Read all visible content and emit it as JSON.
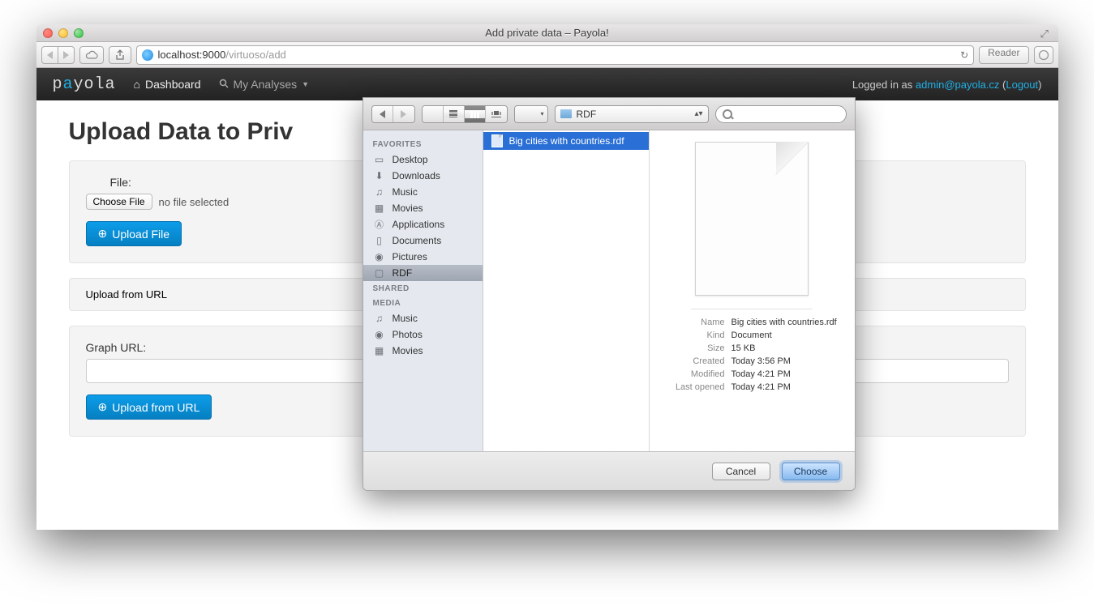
{
  "window": {
    "title": "Add private data – Payola!",
    "url_host": "localhost:9000",
    "url_path": "/virtuoso/add",
    "reader": "Reader"
  },
  "navbar": {
    "brand_p1": "p",
    "brand_accent": "a",
    "brand_p2": "yola",
    "dashboard": "Dashboard",
    "my_analyses": "My Analyses",
    "logged_in_prefix": "Logged in as ",
    "user": "admin@payola.cz",
    "logout": "Logout"
  },
  "page": {
    "heading": "Upload Data to Priv",
    "file_label": "File:",
    "choose_file": "Choose File",
    "no_file": "no file selected",
    "upload_file": "Upload File",
    "upload_from_url_label": "Upload from URL",
    "graph_url_label": "Graph URL:",
    "upload_from_url_btn": "Upload from URL"
  },
  "dialog": {
    "path": "RDF",
    "sidebar": {
      "favorites_header": "FAVORITES",
      "favorites": [
        "Desktop",
        "Downloads",
        "Music",
        "Movies",
        "Applications",
        "Documents",
        "Pictures",
        "RDF"
      ],
      "shared_header": "SHARED",
      "media_header": "MEDIA",
      "media": [
        "Music",
        "Photos",
        "Movies"
      ]
    },
    "file": "Big cities with countries.rdf",
    "info": {
      "name_k": "Name",
      "name_v": "Big cities with countries.rdf",
      "kind_k": "Kind",
      "kind_v": "Document",
      "size_k": "Size",
      "size_v": "15 KB",
      "created_k": "Created",
      "created_v": "Today 3:56 PM",
      "modified_k": "Modified",
      "modified_v": "Today 4:21 PM",
      "opened_k": "Last opened",
      "opened_v": "Today 4:21 PM"
    },
    "cancel": "Cancel",
    "choose": "Choose"
  }
}
